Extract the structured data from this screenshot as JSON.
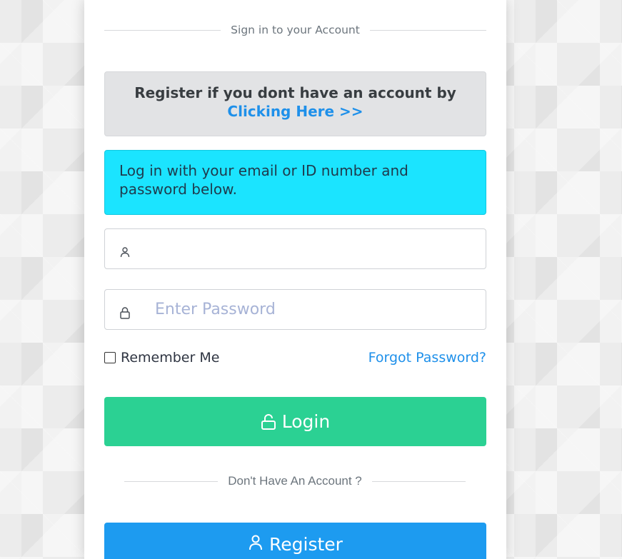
{
  "header": {
    "sign_in_text": "Sign in to your Account"
  },
  "register_notice": {
    "text": "Register if you dont have an account by",
    "link_text": "Clicking Here >>"
  },
  "info_notice": {
    "text": "Log in with your email or ID number and password below."
  },
  "form": {
    "username": {
      "value": "",
      "placeholder": "",
      "icon": "user-icon"
    },
    "password": {
      "value": "",
      "placeholder": "Enter Password",
      "icon": "lock-icon"
    },
    "remember_label": "Remember Me",
    "remember_checked": false,
    "forgot_label": "Forgot Password?",
    "login_label": "Login",
    "login_icon": "unlock-icon"
  },
  "footer": {
    "no_account_text": "Don't Have An Account ?",
    "register_label": "Register",
    "register_icon": "user-icon"
  },
  "colors": {
    "login_button": "#2bd193",
    "register_button": "#1d9bf0",
    "info_alert": "#1be4ff",
    "link": "#1e90ea"
  }
}
